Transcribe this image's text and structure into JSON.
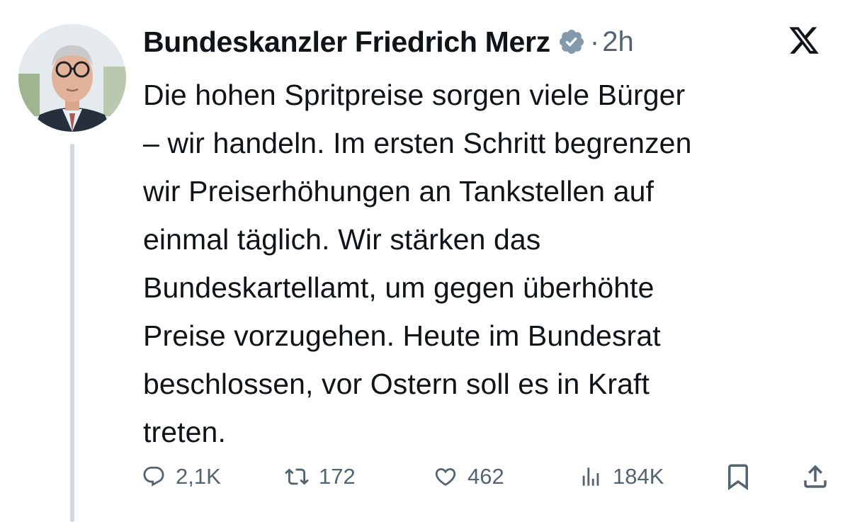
{
  "tweet": {
    "author_name": "Bundeskanzler Friedrich Merz",
    "separator": "·",
    "time": "2h",
    "text": "Die hohen Spritpreise sorgen viele Bürger\n– wir handeln. Im ersten Schritt begrenzen\nwir Preiserhöhungen an Tankstellen auf\neinmal täglich. Wir stärken das\nBundeskartellamt, um gegen überhöhte\nPreise vorzugehen. Heute im Bundesrat\nbeschlossen, vor Ostern soll es in Kraft\ntreten."
  },
  "actions": {
    "replies": "2,1K",
    "reposts": "172",
    "likes": "462",
    "views": "184K"
  },
  "icons": {
    "verified": "verified-badge-icon",
    "platform": "x-logo-icon",
    "reply": "reply-icon",
    "repost": "repost-icon",
    "like": "heart-icon",
    "views": "views-bar-chart-icon",
    "bookmark": "bookmark-icon",
    "share": "share-icon"
  },
  "colors": {
    "text": "#0f1419",
    "secondary": "#536471",
    "verified_badge": "#829aab",
    "thread_line": "#cfd9de"
  }
}
